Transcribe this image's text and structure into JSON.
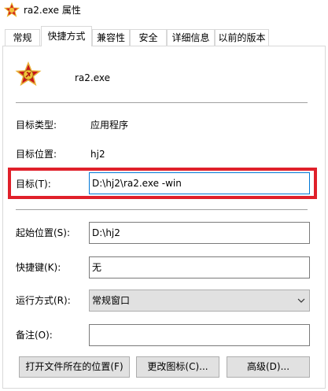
{
  "window": {
    "title": "ra2.exe 属性"
  },
  "tabs": [
    {
      "label": "常规",
      "active": false
    },
    {
      "label": "快捷方式",
      "active": true
    },
    {
      "label": "兼容性",
      "active": false
    },
    {
      "label": "安全",
      "active": false
    },
    {
      "label": "详细信息",
      "active": false
    },
    {
      "label": "以前的版本",
      "active": false
    }
  ],
  "app": {
    "name": "ra2.exe",
    "icon": "soviet-star-icon"
  },
  "info": {
    "target_type_label": "目标类型:",
    "target_type_value": "应用程序",
    "target_location_label": "目标位置:",
    "target_location_value": "hj2"
  },
  "target": {
    "label": "目标(T):",
    "value": "D:\\hj2\\ra2.exe -win"
  },
  "start_in": {
    "label": "起始位置(S):",
    "value": "D:\\hj2"
  },
  "shortcut_key": {
    "label": "快捷键(K):",
    "value": "无"
  },
  "run": {
    "label": "运行方式(R):",
    "value": "常规窗口"
  },
  "comment": {
    "label": "备注(O):",
    "value": ""
  },
  "buttons": {
    "open_location": "打开文件所在的位置(F)",
    "change_icon": "更改图标(C)...",
    "advanced": "高级(D)..."
  },
  "colors": {
    "highlight_box": "#e0202a",
    "focus_border": "#0078d7"
  }
}
